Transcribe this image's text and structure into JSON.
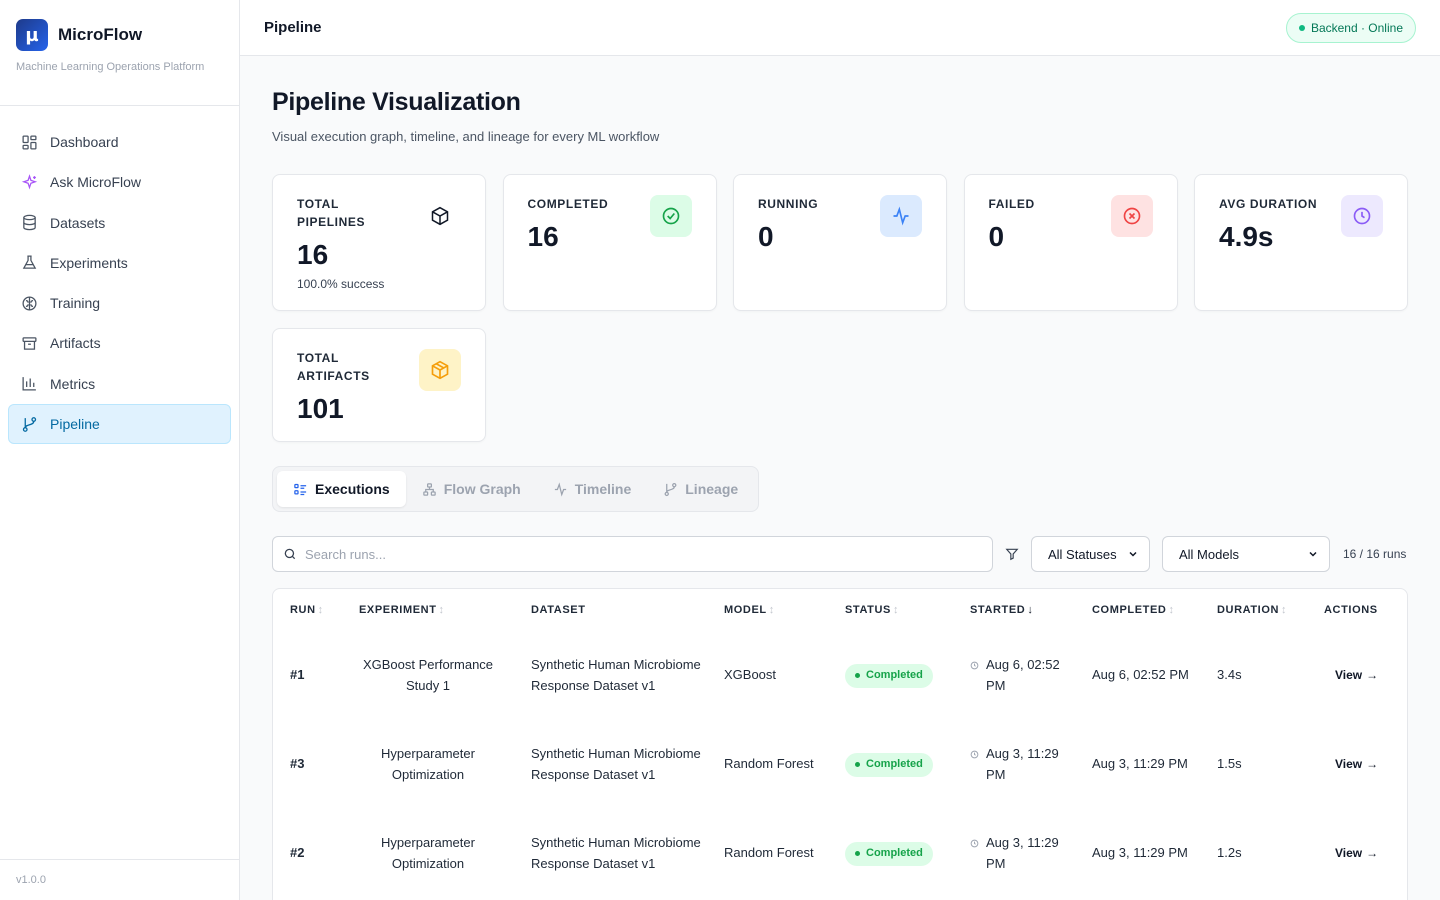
{
  "app": {
    "logo_glyph": "µ",
    "name": "MicroFlow",
    "subtitle": "Machine Learning Operations Platform",
    "version": "v1.0.0"
  },
  "sidebar": {
    "items": [
      {
        "label": "Dashboard",
        "icon": "grid-icon"
      },
      {
        "label": "Ask MicroFlow",
        "icon": "sparkles-icon"
      },
      {
        "label": "Datasets",
        "icon": "database-icon"
      },
      {
        "label": "Experiments",
        "icon": "flask-icon"
      },
      {
        "label": "Training",
        "icon": "brain-icon"
      },
      {
        "label": "Artifacts",
        "icon": "archive-icon"
      },
      {
        "label": "Metrics",
        "icon": "bar-chart-icon"
      },
      {
        "label": "Pipeline",
        "icon": "git-branch-icon",
        "active": true
      }
    ]
  },
  "header": {
    "title": "Pipeline",
    "backend_status": "Backend · Online"
  },
  "page": {
    "title": "Pipeline Visualization",
    "subtitle": "Visual execution graph, timeline, and lineage for every ML workflow"
  },
  "stats": {
    "total_pipelines": {
      "label": "TOTAL PIPELINES",
      "value": "16",
      "sub": "100.0% success"
    },
    "completed": {
      "label": "COMPLETED",
      "value": "16"
    },
    "running": {
      "label": "RUNNING",
      "value": "0"
    },
    "failed": {
      "label": "FAILED",
      "value": "0"
    },
    "avg_duration": {
      "label": "AVG DURATION",
      "value": "4.9s"
    },
    "total_artifacts": {
      "label": "TOTAL ARTIFACTS",
      "value": "101"
    }
  },
  "tabs": [
    {
      "label": "Executions",
      "active": true
    },
    {
      "label": "Flow Graph"
    },
    {
      "label": "Timeline"
    },
    {
      "label": "Lineage"
    }
  ],
  "filters": {
    "search_placeholder": "Search runs...",
    "status_select": "All Statuses",
    "model_select": "All Models",
    "runs_count": "16 / 16 runs"
  },
  "table": {
    "columns": {
      "run": "RUN",
      "experiment": "EXPERIMENT",
      "dataset": "DATASET",
      "model": "MODEL",
      "status": "STATUS",
      "started": "STARTED",
      "completed": "COMPLETED",
      "duration": "DURATION",
      "actions": "ACTIONS"
    },
    "rows": [
      {
        "run": "#1",
        "experiment": "XGBoost Performance Study 1",
        "dataset": "Synthetic Human Microbiome Response Dataset v1",
        "model": "XGBoost",
        "status": "Completed",
        "started": "Aug 6, 02:52 PM",
        "completed": "Aug 6, 02:52 PM",
        "duration": "3.4s",
        "action": "View"
      },
      {
        "run": "#3",
        "experiment": "Hyperparameter Optimization",
        "dataset": "Synthetic Human Microbiome Response Dataset v1",
        "model": "Random Forest",
        "status": "Completed",
        "started": "Aug 3, 11:29 PM",
        "completed": "Aug 3, 11:29 PM",
        "duration": "1.5s",
        "action": "View"
      },
      {
        "run": "#2",
        "experiment": "Hyperparameter Optimization",
        "dataset": "Synthetic Human Microbiome Response Dataset v1",
        "model": "Random Forest",
        "status": "Completed",
        "started": "Aug 3, 11:29 PM",
        "completed": "Aug 3, 11:29 PM",
        "duration": "1.2s",
        "action": "View"
      }
    ]
  },
  "colors": {
    "accent": "#0369a1",
    "success": "#16a34a",
    "danger": "#ef4444",
    "info": "#3b82f6",
    "purple": "#8b5cf6",
    "amber": "#f59e0b"
  }
}
